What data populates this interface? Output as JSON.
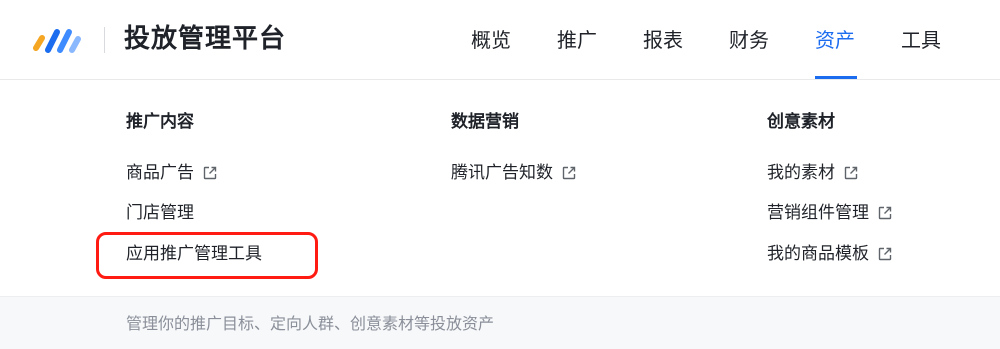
{
  "header": {
    "title": "投放管理平台",
    "logo": "brand-logo",
    "accent_color": "#1c6cf0"
  },
  "nav": {
    "items": [
      {
        "label": "概览"
      },
      {
        "label": "推广"
      },
      {
        "label": "报表"
      },
      {
        "label": "财务"
      },
      {
        "label": "资产",
        "active": true
      },
      {
        "label": "工具"
      }
    ]
  },
  "menu": {
    "columns": [
      {
        "title": "推广内容",
        "items": [
          {
            "label": "商品广告",
            "external": true
          },
          {
            "label": "门店管理",
            "external": false
          },
          {
            "label": "应用推广管理工具",
            "external": false,
            "highlighted": true
          }
        ]
      },
      {
        "title": "数据营销",
        "items": [
          {
            "label": "腾讯广告知数",
            "external": true
          }
        ]
      },
      {
        "title": "创意素材",
        "items": [
          {
            "label": "我的素材",
            "external": true
          },
          {
            "label": "营销组件管理",
            "external": true
          },
          {
            "label": "我的商品模板",
            "external": true
          }
        ]
      }
    ],
    "external_icon": "external-link-icon",
    "highlight_color": "#ff1a12"
  },
  "footer": {
    "description": "管理你的推广目标、定向人群、创意素材等投放资产"
  }
}
